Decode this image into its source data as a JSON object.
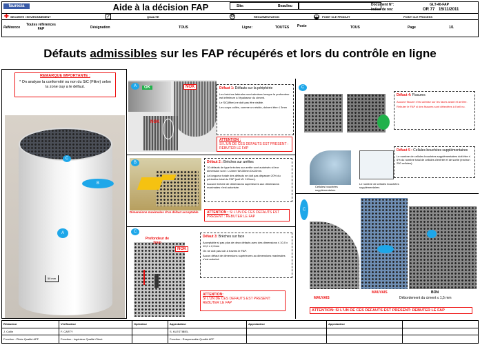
{
  "header": {
    "logo": "faurecia",
    "title": "Aide à la décision FAP",
    "site_label": "Site:",
    "site_value": "Beaulieu",
    "doc_no_label": "Document N°:",
    "doc_no_value": "GLT-40-FAP",
    "edition_label": "Indice de rev:",
    "edition_value": "OR 77",
    "date_value": "15/11/2011",
    "icons_row": [
      {
        "icon": "red-cross-icon",
        "label": "SECURITE / ENVIRONNEMENT"
      },
      {
        "icon": "check-icon",
        "label": "QUALITE"
      },
      {
        "icon": "gear-circle-icon",
        "label": "REGLEMENTATION"
      },
      {
        "icon": "phone-icon",
        "label": "POINT CLE PRODUIT"
      },
      {
        "icon": "",
        "label": "POINT CLE PROCESS"
      }
    ],
    "ref_label": "Référence",
    "ref_value": "Toutes références FAP",
    "designation_label": "Désignation",
    "designation_value": "TOUS",
    "ligne_label": "Ligne:",
    "ligne_value": "TOUTES",
    "poste_label": "Poste",
    "poste_value": "TOUS",
    "page_label": "Page",
    "page_value": "1/1"
  },
  "main_title": {
    "part1": "Défauts ",
    "part2": "admissibles",
    "part3": " sur les FAP récupérés et lors du contrôle en ligne"
  },
  "remark": {
    "title": "REMARQUE IMPORTANTE :",
    "text": "* On analyse la conformité ou non du SiC (Filtre) selon la zone ouy a le défaut."
  },
  "cylinder": {
    "label_a": "A",
    "label_b": "B",
    "label_c": "C",
    "dim": "50 mm"
  },
  "section_a": {
    "badge": "A",
    "ok": "OK",
    "nok1": "NOK",
    "nok2": "NOK",
    "title": "Défaut 1:",
    "title_rest": "Défauts sur la périphérie",
    "bullets": [
      "Les brèches latérales sont admises lorsque la profondeur est inférieure à l'épaisseur du ciment.",
      "Le SiC(filtre) ne doit pas être visible.",
      "Les corps collés, comme un résidu, doivent être ≤ 3mm"
    ],
    "attention_title": "ATTENTION :",
    "attention_text": "SI L'UN DE CES DEFAUTS EST PRESENT : REBUTER LE FAP"
  },
  "section_b": {
    "badge": "B",
    "caption": "Dimensions maximales d'un défaut acceptable",
    "title": "Défaut 2 :",
    "title_rest": "Brèches sur arrêtes",
    "bullets": [
      "10 défauts de type brèches sur arrête sont autorisés si leur dimension sont : L≤4mm W≤30mm D≤10mm.",
      "La longueur totale des défauts ne doit pas dépasser 20% du périmètre total du FAP (soit W: 110mm).",
      "Aucune brèche de dimensions supérieures aux dimensions maximales n'est autorisée."
    ],
    "attention_title": "ATTENTION :",
    "attention_text": "SI L'UN DE CES DEFAUTS EST PRESENT : REBUTER LE FAP"
  },
  "section_c1": {
    "badge": "C",
    "depth_label": "Profondeur de 2mm",
    "nok": "NOK",
    "title": "Défaut 3:",
    "title_rest": "Brèches sur face",
    "bullets": [
      "Acceptable si pas plus de deux défauts avec des dimensions ≤ 10,0 x 10,0 x 2,0mm",
      "On ne doit pas voir à travers le FAP.",
      "Aucun défaut de dimensions supérieures au dimensions maximales n'est autorisé"
    ],
    "attention_title": "ATTENTION:",
    "attention_text": "SI L'UN DE CES DEFAUTS EST PRESENT: REBUTER LE FAP"
  },
  "section_c2": {
    "badge": "C",
    "title": "Défaut 4:",
    "title_rest": "Fissures",
    "bullets": [
      "Aucune fissure n'est admise sur les faces avant et arrière.",
      "Rebuter le FAP si des fissures sont détectées à l'oeil nu."
    ],
    "caption1": "Cellules bouchées supplémentaires",
    "caption2": "Le nombre de cellules bouchées supplémentaires"
  },
  "section_c3": {
    "title": "Défaut 5 :",
    "title_rest": "Cellules bouchées supplémentaires",
    "bullets": [
      "Le nombre de cellules bouchées supplémentaires doit être ≤ 6% du nombre total de cellules d'entrée et de sortie (environ 250 cellules)."
    ]
  },
  "section_c4": {
    "badge": "C",
    "mauvais1": "MAUVAIS",
    "mauvais2": "MAUVAIS",
    "bon": "BON",
    "note": "Débordement du ciment ≤ 1,5 mm",
    "attention": "ATTENTION: SI L'UN DE CES DEFAUTS EST PRESENT: REBUTER LE FAP"
  },
  "footer": {
    "cols": [
      {
        "label": "Rédacteur",
        "value": "J. Collin",
        "sub": "Fonction : Pilote Qualité APF"
      },
      {
        "label": "Vérificateur",
        "value": "F. CARTY",
        "sub": "Fonction : Ingénieur Qualité Client"
      },
      {
        "label": "Opérateur",
        "value": "",
        "sub": ""
      },
      {
        "label": "Approbateur",
        "value": "S. KLESTIBIEL",
        "sub": "Fonction : Responsable Qualité APF"
      },
      {
        "label": "Approbateur",
        "value": "",
        "sub": ""
      },
      {
        "label": "Approbateur",
        "value": "",
        "sub": ""
      }
    ]
  },
  "colors": {
    "accent_red": "#e11111",
    "badge_blue": "#1ea7e9",
    "green": "#21b14b"
  }
}
